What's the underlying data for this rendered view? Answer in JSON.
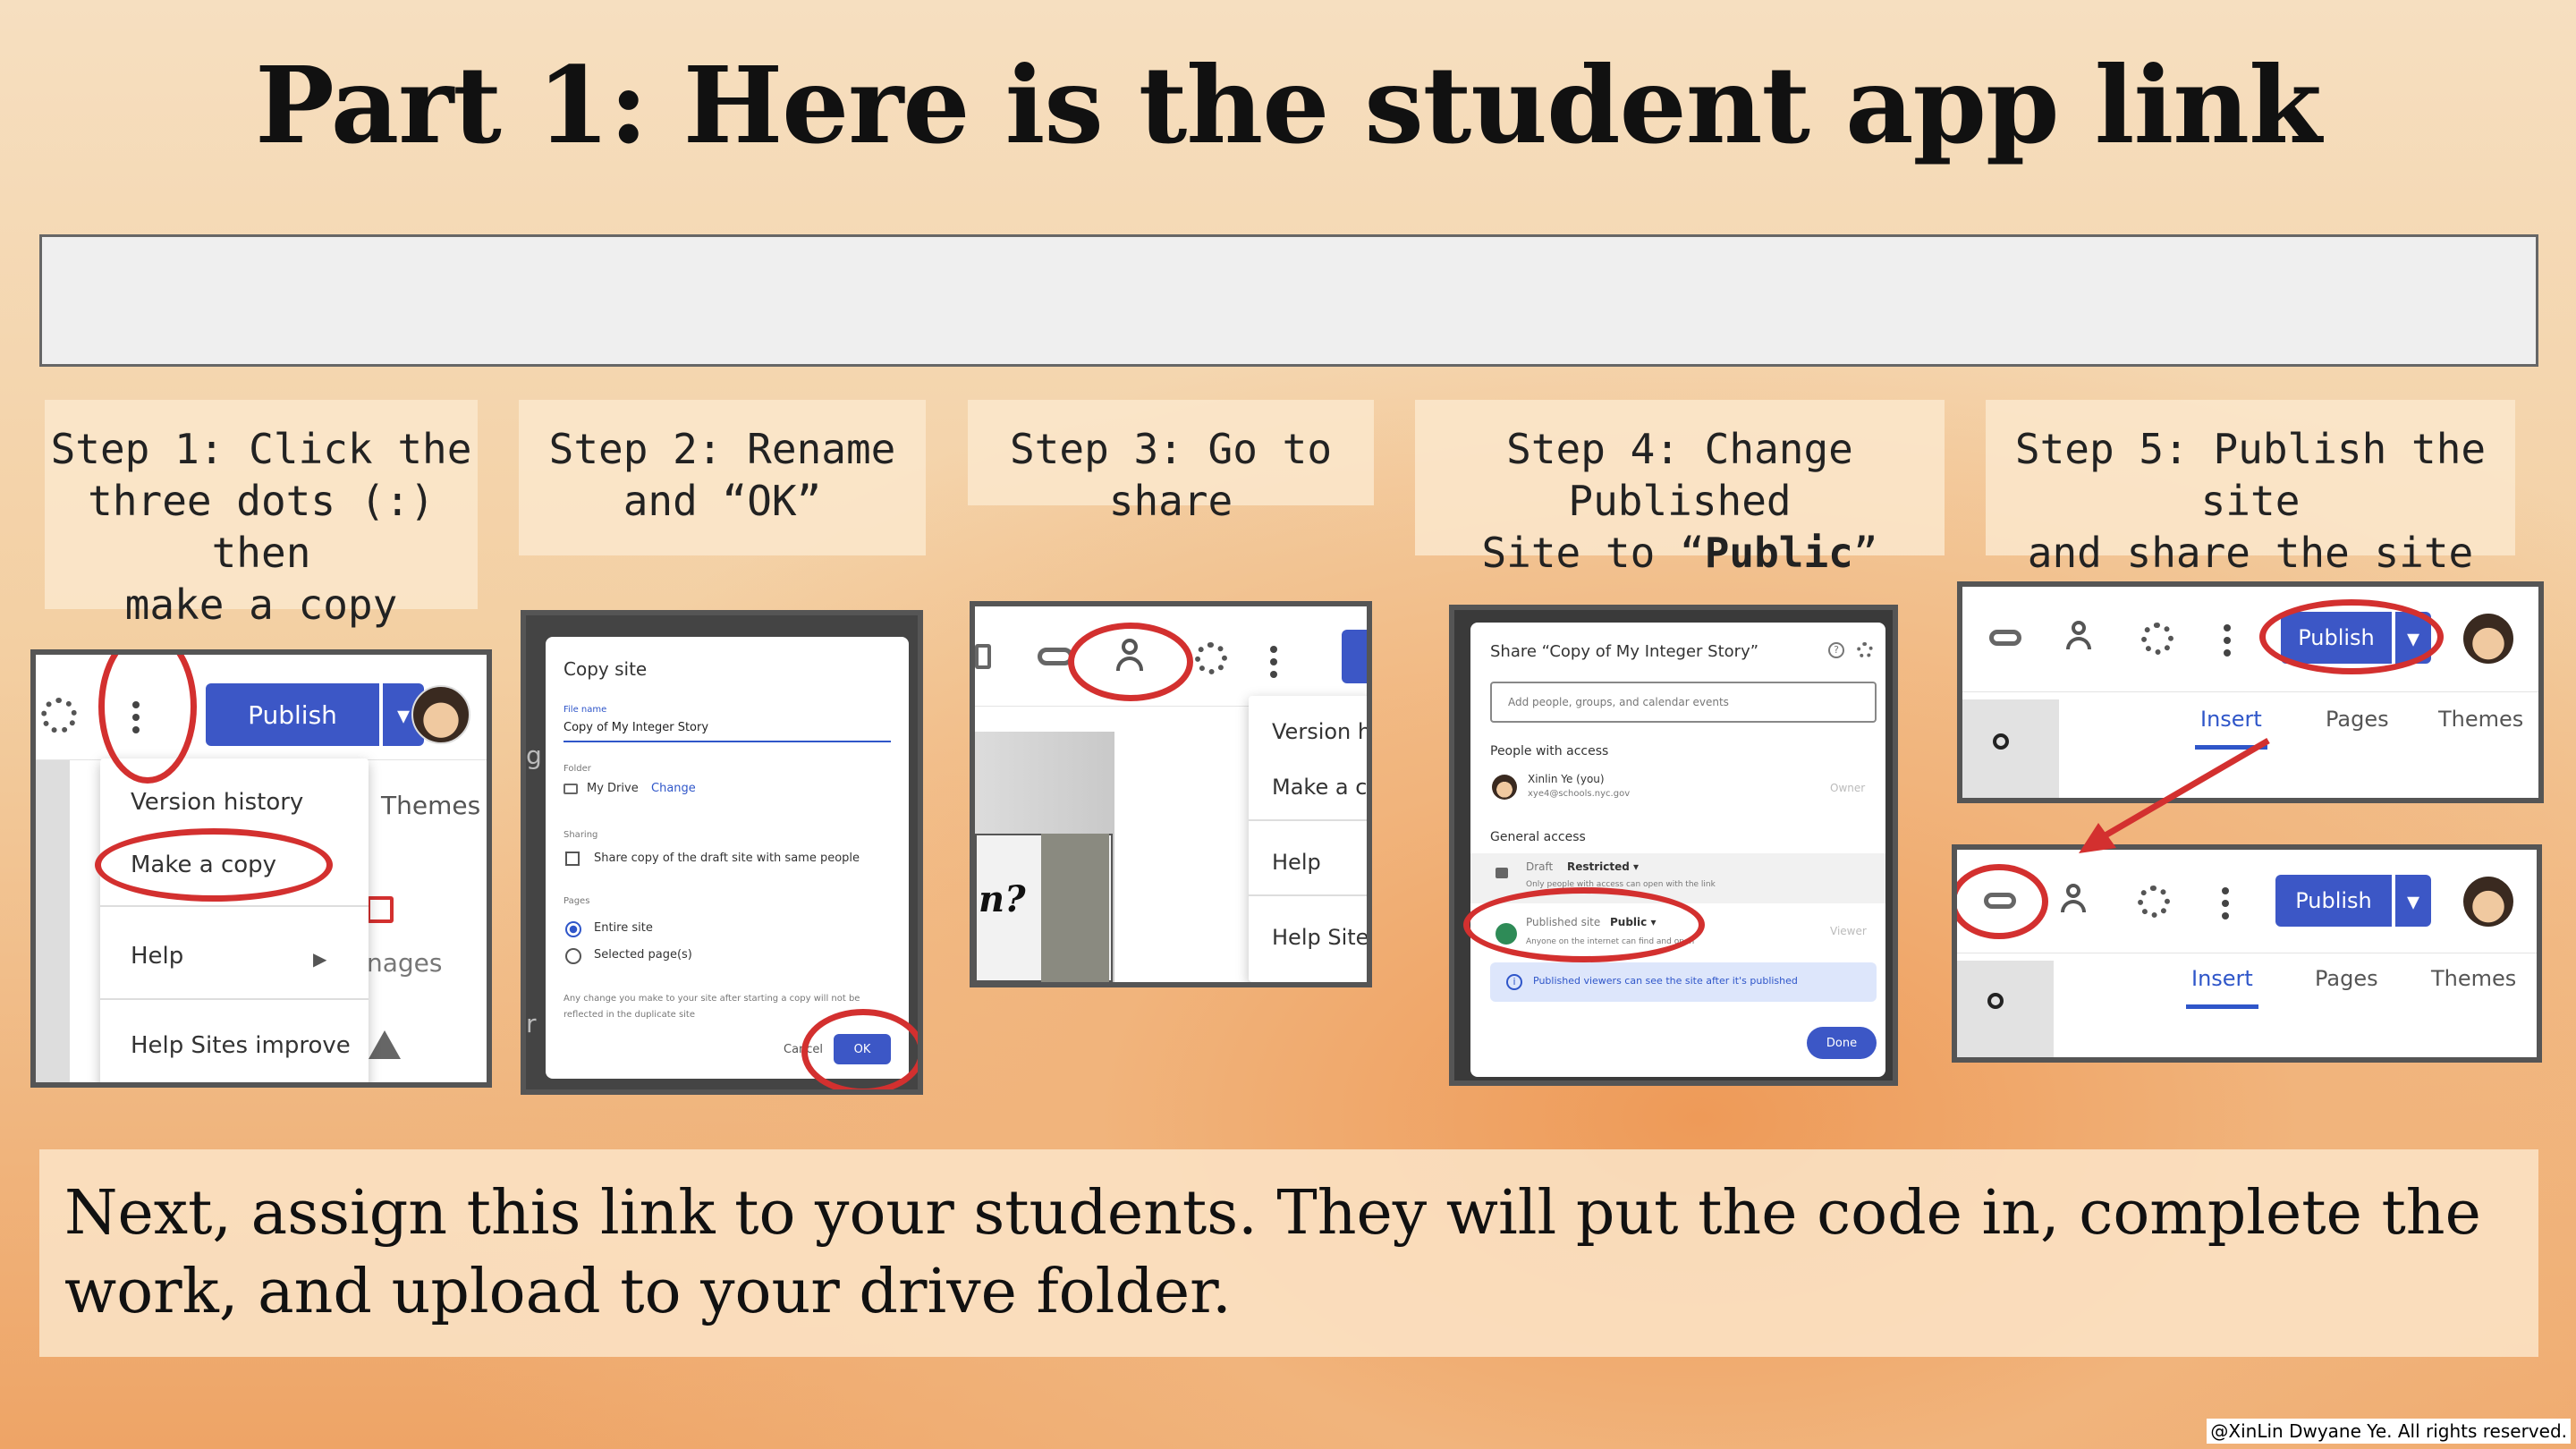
{
  "title": "Part 1: Here is the student app link",
  "link_box": "",
  "steps": [
    {
      "l1": "Step 1: Click the",
      "l2": "three dots (:) then",
      "l3": "make a copy"
    },
    {
      "l1": "Step 2: Rename",
      "l2": "and “OK”"
    },
    {
      "l1": "Step 3: Go to share"
    },
    {
      "l1": "Step 4: Change Published",
      "l2a": "Site to “",
      "l2b": "Public",
      "l2c": "”"
    },
    {
      "l1": "Step 5: Publish the site",
      "l2": "and share the site link!"
    }
  ],
  "shot1": {
    "publish": "Publish",
    "menu": [
      "Version history",
      "Make a copy",
      "Help",
      "Help Sites improve"
    ],
    "themes": "Themes",
    "images": "nages"
  },
  "shot2": {
    "title": "Copy site",
    "file_name_label": "File name",
    "file_name": "Copy of My Integer Story",
    "folder_label": "Folder",
    "folder": "My Drive",
    "change": "Change",
    "sharing_label": "Sharing",
    "sharing": "Share copy of the draft site with same people",
    "pages_label": "Pages",
    "entire": "Entire site",
    "selected": "Selected page(s)",
    "note": "Any change you make to your site after starting a copy will not be reflected in the duplicate site",
    "cancel": "Cancel",
    "ok": "OK",
    "left_glyph": "g",
    "left_glyph2": "r"
  },
  "shot3": {
    "menu": [
      "Version hi",
      "Make a co",
      "Help",
      "Help Sites"
    ],
    "partial": "n?"
  },
  "shot4": {
    "title": "Share “Copy of My Integer Story”",
    "add_placeholder": "Add people, groups, and calendar events",
    "people": "People with access",
    "user": "Xinlin Ye (you)",
    "email": "xye4@schools.nyc.gov",
    "owner": "Owner",
    "general": "General access",
    "draft": "Draft",
    "restricted": "Restricted",
    "draft_note": "Only people with access can open with the link",
    "published": "Published site",
    "public": "Public",
    "pub_note": "Anyone on the internet can find and open",
    "viewer": "Viewer",
    "info": "Published viewers can see the site after it's published",
    "done": "Done"
  },
  "shot5": {
    "publish": "Publish",
    "tabs": [
      "Insert",
      "Pages",
      "Themes"
    ]
  },
  "bottom": {
    "line1": "Next, assign this link to your students. They will put the code in, complete the",
    "line2": "work, and upload to your drive folder."
  },
  "copyright": "@XinLin Dwyane Ye. All rights reserved.",
  "colors": {
    "accent": "#3c57c6",
    "circle": "#d3302f"
  }
}
